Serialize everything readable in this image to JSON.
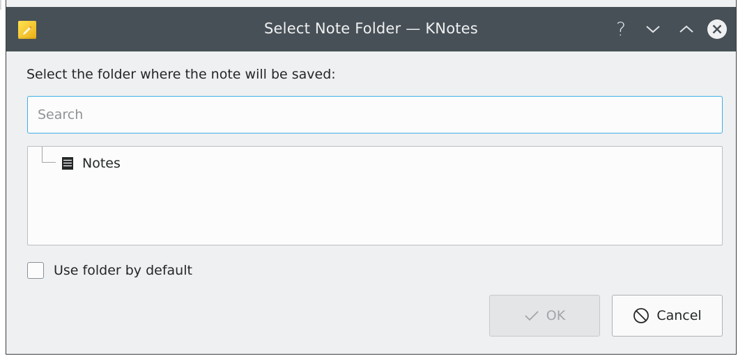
{
  "window": {
    "title": "Select Note Folder — KNotes",
    "help_label": "?"
  },
  "dialog": {
    "prompt": "Select the folder where the note will be saved:",
    "search": {
      "placeholder": "Search",
      "value": ""
    },
    "tree": {
      "items": [
        {
          "label": "Notes",
          "icon": "notes-folder-icon"
        }
      ]
    },
    "default_checkbox": {
      "label": "Use folder by default",
      "checked": false
    },
    "buttons": {
      "ok_label": "OK",
      "cancel_label": "Cancel"
    }
  },
  "colors": {
    "titlebar": "#475057",
    "accent": "#3daee9",
    "background": "#eff0f1"
  }
}
